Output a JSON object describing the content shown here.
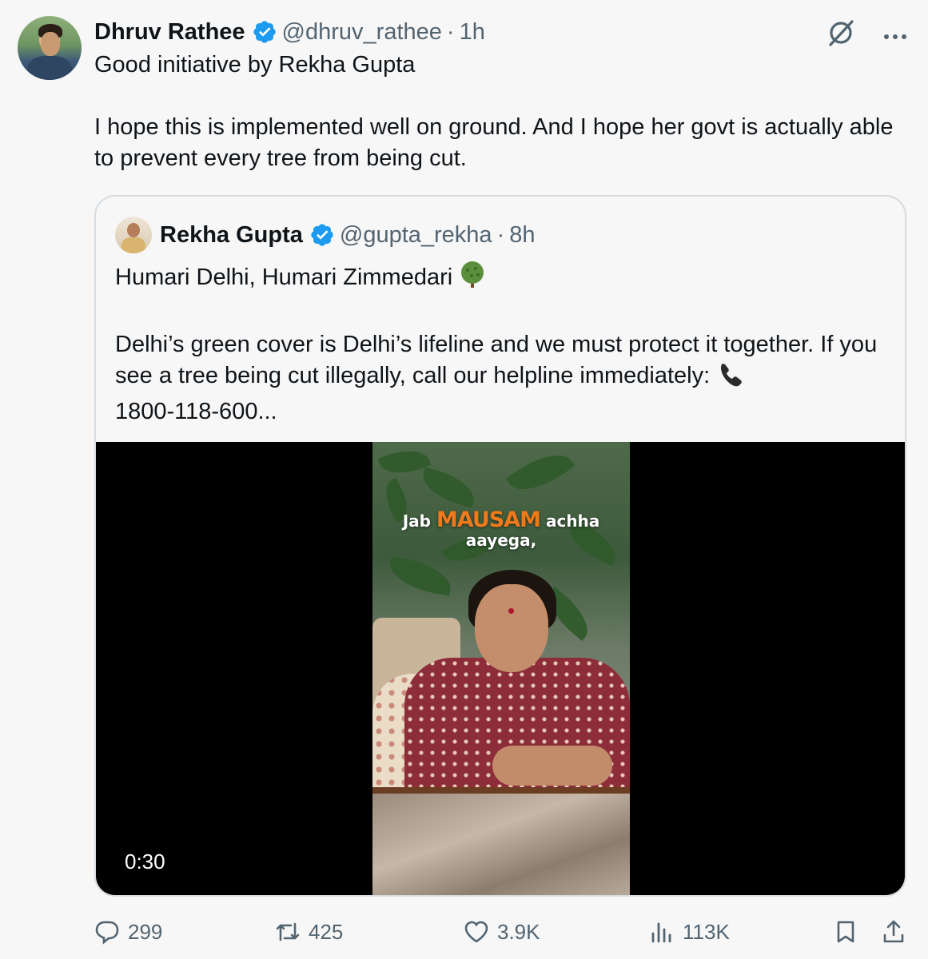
{
  "tweet": {
    "author_name": "Dhruv Rathee",
    "handle": "@dhruv_rathee",
    "separator": "·",
    "time": "1h",
    "text_line1": "Good initiative by Rekha Gupta",
    "text_line2": "I hope this is implemented well on ground. And I hope her govt is actually able to prevent every tree from being cut."
  },
  "quote": {
    "author_name": "Rekha Gupta",
    "handle": "@gupta_rekha",
    "separator": "·",
    "time": "8h",
    "text_line1": "Humari Delhi, Humari Zimmedari",
    "text_line2": "Delhi’s green cover is Delhi’s lifeline and we must protect it together. If you see a tree being cut illegally, call our helpline immediately:",
    "text_line3": "1800-118-600...",
    "video": {
      "caption_pre": "Jab",
      "caption_highlight": "MAUSAM",
      "caption_post": "achha",
      "caption_line2": "aayega,",
      "duration": "0:30"
    }
  },
  "actions": {
    "replies": "299",
    "reposts": "425",
    "likes": "3.9K",
    "views": "113K"
  },
  "colors": {
    "verified": "#1d9bf0",
    "secondary_text": "#536471",
    "caption_highlight": "#f07a1a"
  }
}
